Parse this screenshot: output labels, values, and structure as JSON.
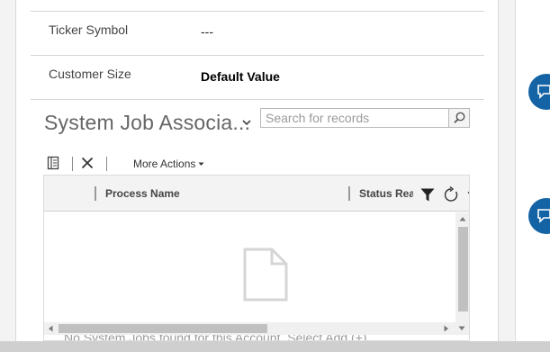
{
  "fields": [
    {
      "label": "Ticker Symbol",
      "value": "---"
    },
    {
      "label": "Customer Size",
      "value": "Default Value"
    }
  ],
  "subgrid": {
    "title": "System Job Associa...",
    "search_placeholder": "Search for records",
    "commands": {
      "more_actions": "More Actions"
    },
    "columns": [
      "Process Name",
      "Status Reas"
    ],
    "empty_message": "No System Jobs found for this Account. Select Add (+)"
  },
  "colors": {
    "accent": "#1464a5",
    "border": "#d6d6d6",
    "header_bg": "#f3f3f3"
  },
  "icons": [
    "views-icon",
    "close-icon",
    "chevron-down-icon",
    "search-icon",
    "filter-icon",
    "refresh-icon",
    "document-icon",
    "chat-icon"
  ]
}
